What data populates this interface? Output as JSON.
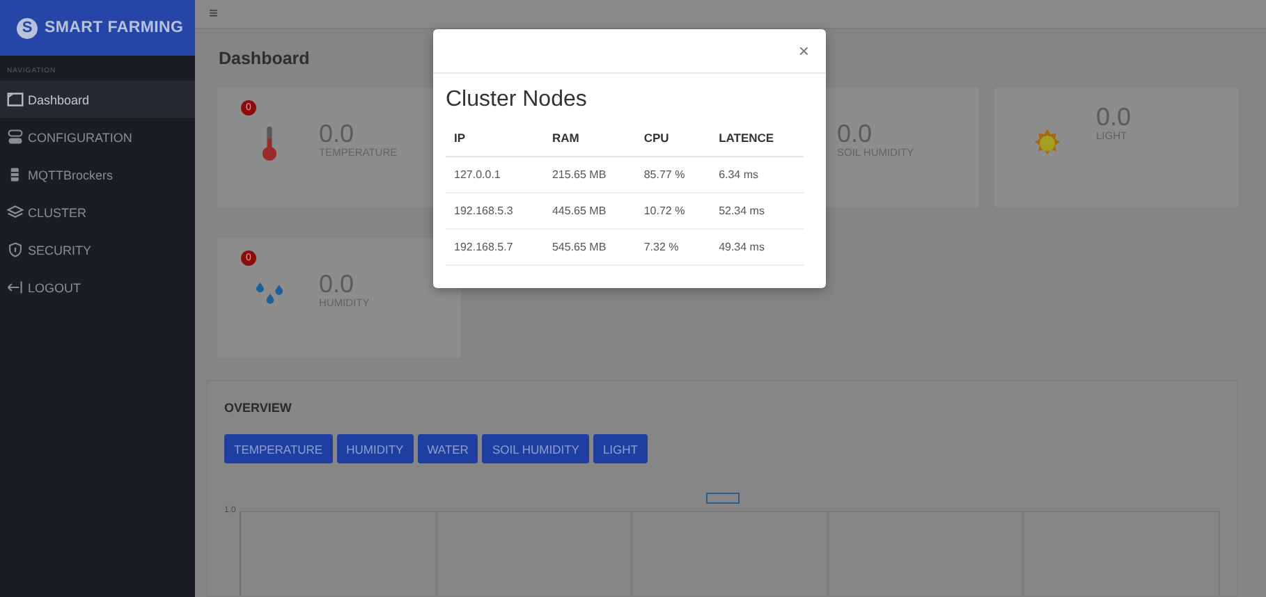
{
  "brand": {
    "logo_letter": "S",
    "name": "SMART FARMING"
  },
  "topbar": {
    "menu_glyph": "≡"
  },
  "sidebar": {
    "heading": "NAVIGATION",
    "items": [
      {
        "label": "Dashboard",
        "kind": "dashboard",
        "selected": true
      },
      {
        "label": "CONFIGURATION",
        "kind": "toggle",
        "selected": false
      },
      {
        "label": "MQTTBrockers",
        "kind": "server",
        "selected": false
      },
      {
        "label": "CLUSTER",
        "kind": "layers",
        "selected": false
      },
      {
        "label": "SECURITY",
        "kind": "shield",
        "selected": false
      },
      {
        "label": "LOGOUT",
        "kind": "logout",
        "selected": false
      }
    ]
  },
  "page_title": "Dashboard",
  "cards": [
    {
      "badge": "0",
      "kind": "temperature",
      "value": "0.0",
      "label": "TEMPERATURE"
    },
    {
      "kind": "soil",
      "value": "0.0",
      "label": "SOIL HUMIDITY"
    },
    {
      "kind": "light",
      "value": "0.0",
      "label": "LIGHT"
    },
    {
      "badge": "0",
      "kind": "humidity",
      "value": "0.0",
      "label": "HUMIDITY"
    }
  ],
  "overview": {
    "title": "OVERVIEW",
    "buttons": [
      "TEMPERATURE",
      "HUMIDITY",
      "WATER",
      "SOIL HUMIDITY",
      "LIGHT"
    ],
    "y_tick_label": "1.0"
  },
  "modal": {
    "close": "×",
    "title": "Cluster Nodes",
    "columns": [
      "IP",
      "RAM",
      "CPU",
      "LATENCE"
    ],
    "rows": [
      [
        "127.0.0.1",
        "215.65 MB",
        "85.77 %",
        "6.34 ms"
      ],
      [
        "192.168.5.3",
        "445.65 MB",
        "10.72 %",
        "52.34 ms"
      ],
      [
        "192.168.5.7",
        "545.65 MB",
        "7.32 %",
        "49.34 ms"
      ]
    ]
  }
}
